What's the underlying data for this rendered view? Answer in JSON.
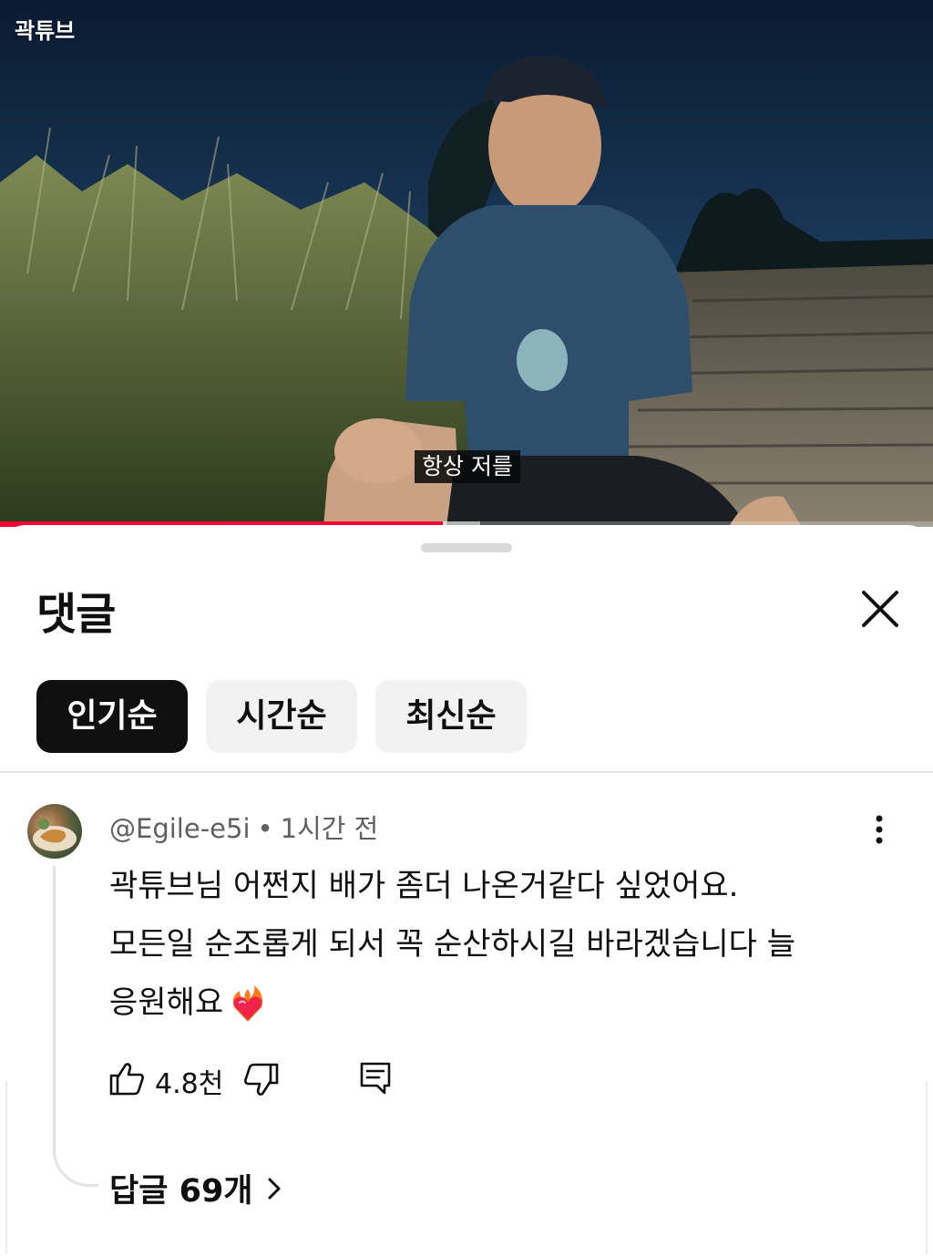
{
  "video": {
    "channel_watermark": "곽튜브",
    "caption": "항상 저를",
    "progress_played": 0.475,
    "progress_buffered": 0.515,
    "accent_color": "#ff0033"
  },
  "comments_panel": {
    "title": "댓글",
    "close_icon": "close-icon",
    "sort_chips": [
      {
        "label": "인기순",
        "selected": true
      },
      {
        "label": "시간순",
        "selected": false
      },
      {
        "label": "최신순",
        "selected": false
      }
    ]
  },
  "comment": {
    "author": "@Egile-e5i",
    "separator": "•",
    "time": "1시간 전",
    "text_lines": [
      "곽튜브님 어쩐지 배가 좀더 나온거같다 싶었어요.",
      "모든일 순조롭게 되서 꼭 순산하시길 바라겠습니다 늘",
      "응원해요"
    ],
    "emoji": "heart-on-fire-emoji",
    "like_count": "4.8천",
    "replies_label": "답글 69개",
    "icons": [
      "thumb-up-icon",
      "thumb-down-icon",
      "reply-icon",
      "more-vert-icon",
      "chevron-right-icon"
    ]
  }
}
